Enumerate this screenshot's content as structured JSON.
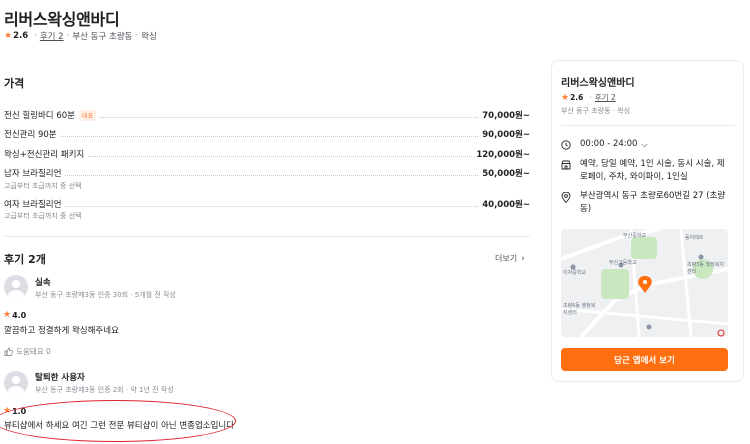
{
  "header": {
    "title": "리버스왁싱앤바디",
    "rating": "2.6",
    "review_link": "후기 2",
    "location": "부산 동구 초량동",
    "category": "왁싱"
  },
  "price": {
    "title": "가격",
    "items": [
      {
        "name": "전신 힐링바디 60분",
        "badge": "대표",
        "sub": "",
        "value": "70,000원~"
      },
      {
        "name": "전신관리 90분",
        "badge": "",
        "sub": "",
        "value": "90,000원~"
      },
      {
        "name": "왁싱+전신관리 패키지",
        "badge": "",
        "sub": "",
        "value": "120,000원~"
      },
      {
        "name": "남자 브라질리언",
        "badge": "",
        "sub": "고급부터 초급까지 중 선택",
        "value": "50,000원~"
      },
      {
        "name": "여자 브라질리언",
        "badge": "",
        "sub": "고급부터 초급까지 중 선택",
        "value": "40,000원~"
      }
    ]
  },
  "reviews": {
    "title": "후기 2개",
    "more_label": "더보기",
    "items": [
      {
        "name": "실속",
        "meta": "부산 동구 초량제3동 인증 30회 · 5개월 전 작성",
        "rating": "4.0",
        "text": "깔끔하고 정결하게 왁싱해주네요",
        "helpful": "도움돼요 0"
      },
      {
        "name": "탈퇴한 사용자",
        "meta": "부산 동구 초량제3동 인증 2회 · 약 1년 전 작성",
        "rating": "1.0",
        "text": "뷰티샵에서 하세요 여긴 그런 전문 뷰티샵이 아닌 변종업소입니다"
      }
    ]
  },
  "card": {
    "title": "리버스왁싱앤바디",
    "rating": "2.6",
    "review_link": "후기 2",
    "address_short": "부산 동구 초량동 · 왁싱",
    "hours": "00:00 - 24:00",
    "facilities": "예약, 당일 예약, 1인 시술, 동시 시술, 제로페이, 주차, 와이파이, 1인실",
    "address": "부산광역시 동구 초량로60번길 27 (초량동)",
    "cta": "당근 앱에서 보기",
    "map_labels": [
      "부산중학교",
      "동아레르",
      "부산고등학교",
      "이자중학교",
      "초량3동 행정복지센터",
      "초량6동 행정복지센터"
    ]
  },
  "colors": {
    "accent": "#ff6f0f",
    "star": "#ff7e36",
    "annotation": "#e0242d"
  }
}
